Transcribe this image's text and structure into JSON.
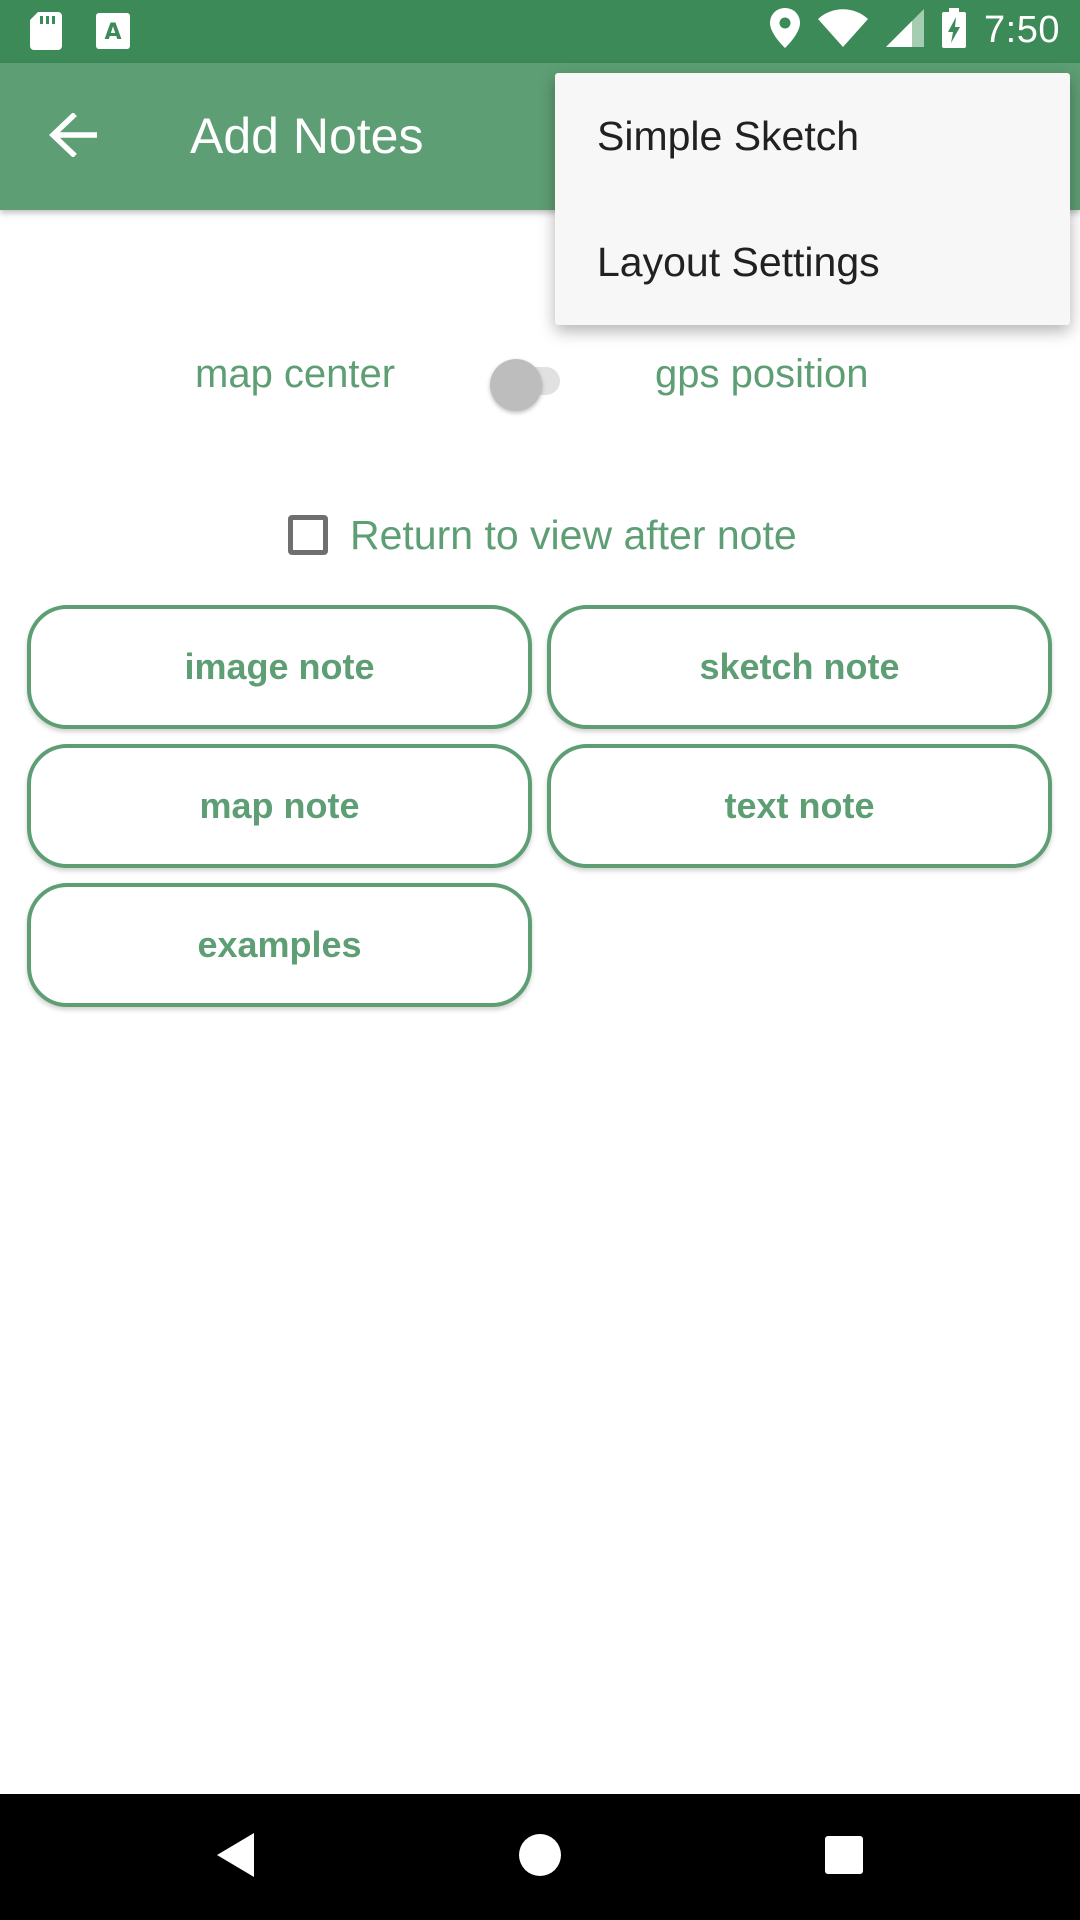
{
  "status_bar": {
    "time": "7:50",
    "icons": [
      "sd-card-icon",
      "a-notification-icon",
      "location-icon",
      "wifi-icon",
      "signal-icon",
      "battery-charging-icon"
    ]
  },
  "app_bar": {
    "title": "Add Notes",
    "back_icon": "arrow-back-icon"
  },
  "position_switch": {
    "left_label": "map center",
    "right_label": "gps position",
    "state": "off"
  },
  "return_checkbox": {
    "label": "Return to view after note",
    "checked": false
  },
  "buttons": {
    "image_note": "image note",
    "sketch_note": "sketch note",
    "map_note": "map note",
    "text_note": "text note",
    "examples": "examples"
  },
  "overflow_menu": {
    "items": [
      {
        "label": "Simple Sketch"
      },
      {
        "label": "Layout Settings"
      }
    ]
  },
  "nav_bar": {
    "icons": [
      "back-triangle-icon",
      "home-circle-icon",
      "recents-square-icon"
    ]
  },
  "colors": {
    "status_bar": "#3d8a59",
    "app_bar": "#5e9e74",
    "accent": "#5e9e74"
  }
}
